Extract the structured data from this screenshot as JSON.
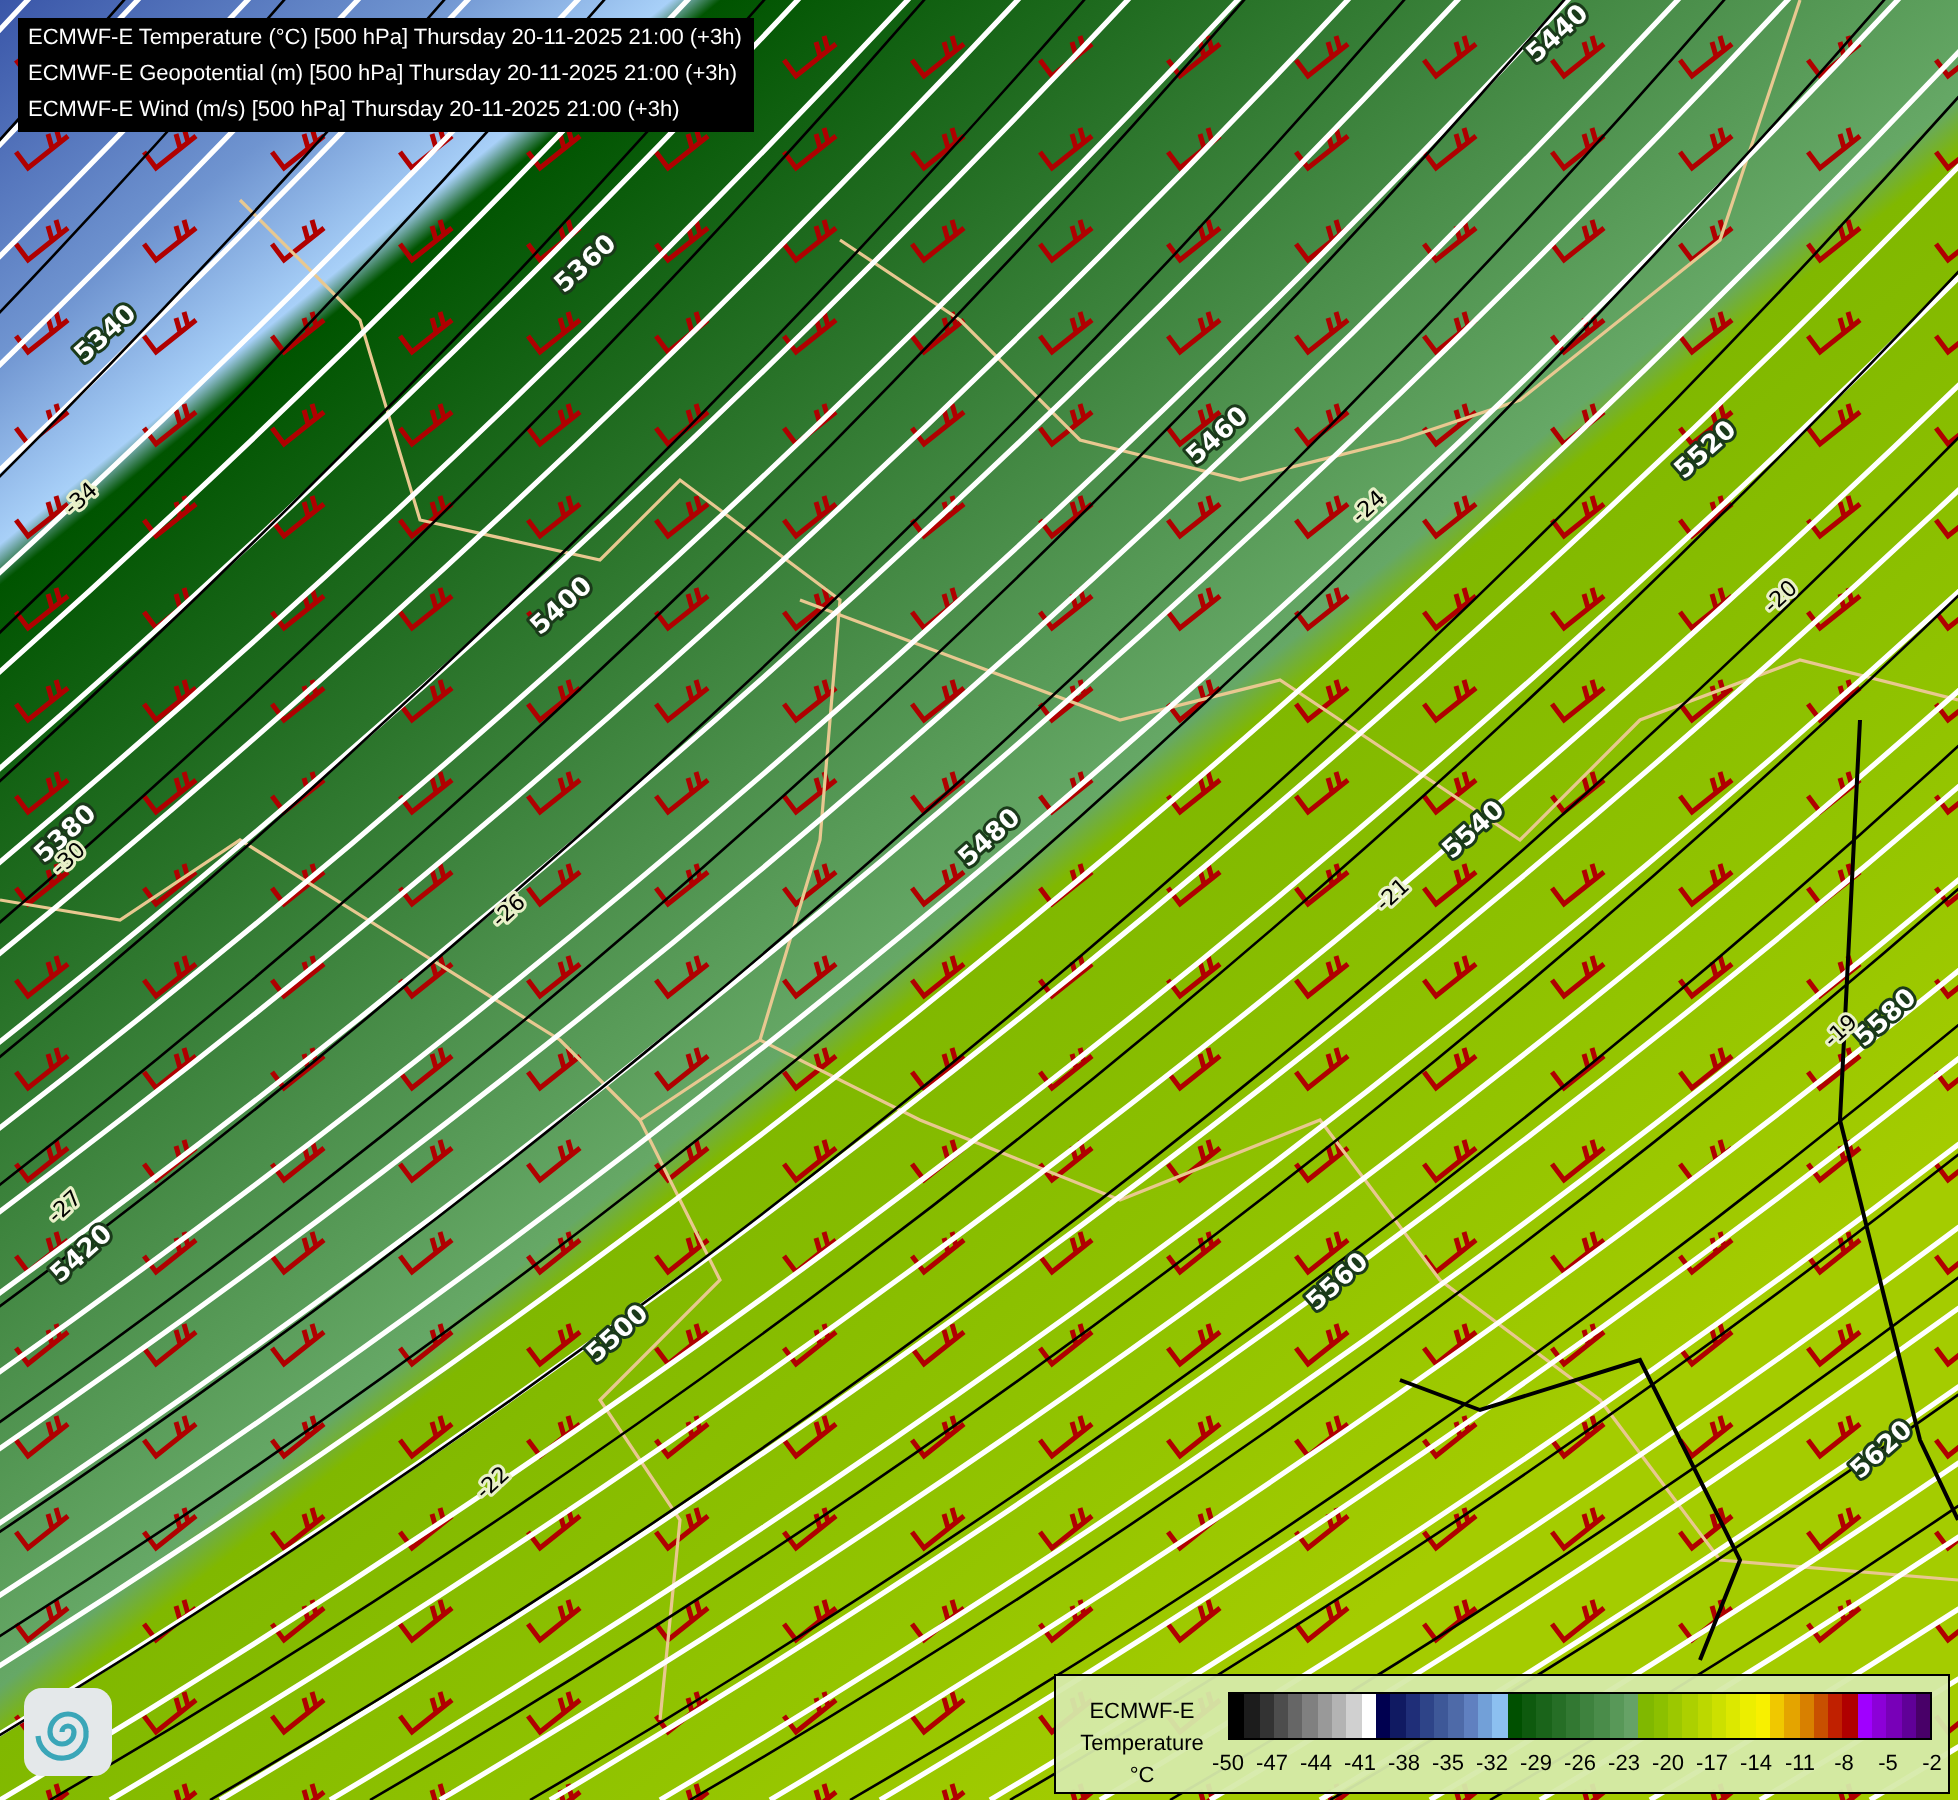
{
  "map": {
    "header_lines": [
      "ECMWF-E Temperature (°C) [500 hPa] Thursday 20-11-2025 21:00 (+3h)",
      "ECMWF-E Geopotential (m) [500 hPa] Thursday 20-11-2025 21:00 (+3h)",
      "ECMWF-E Wind (m/s) [500 hPa] Thursday 20-11-2025 21:00 (+3h)"
    ],
    "geopotential_labels": [
      "5340",
      "5360",
      "5380",
      "5400",
      "5420",
      "5440",
      "5460",
      "5480",
      "5500",
      "5520",
      "5540",
      "5560",
      "5580",
      "5620"
    ],
    "temperature_labels": [
      "-34",
      "-30",
      "-26",
      "-27",
      "-24",
      "-22",
      "-21",
      "-20",
      "-19"
    ]
  },
  "legend": {
    "model": "ECMWF-E",
    "quantity": "Temperature",
    "unit": "°C",
    "swatches": [
      {
        "color": "#000000"
      },
      {
        "color": "#1c1c1c"
      },
      {
        "color": "#333333"
      },
      {
        "color": "#4d4d4d"
      },
      {
        "color": "#666666"
      },
      {
        "color": "#808080"
      },
      {
        "color": "#999999"
      },
      {
        "color": "#b3b3b3"
      },
      {
        "color": "#d0d0d0"
      },
      {
        "color": "#ffffff"
      },
      {
        "color": "#000050"
      },
      {
        "color": "#101a62"
      },
      {
        "color": "#1f2e78"
      },
      {
        "color": "#2e4488"
      },
      {
        "color": "#3e5898"
      },
      {
        "color": "#4e6aa8"
      },
      {
        "color": "#6080c0"
      },
      {
        "color": "#72a0d8"
      },
      {
        "color": "#8cc0f0"
      },
      {
        "color": "#005000"
      },
      {
        "color": "#0e5a0e"
      },
      {
        "color": "#1a641a"
      },
      {
        "color": "#266e26"
      },
      {
        "color": "#327832"
      },
      {
        "color": "#3e823e"
      },
      {
        "color": "#4a8c4a"
      },
      {
        "color": "#589858"
      },
      {
        "color": "#66a266"
      },
      {
        "color": "#80b800"
      },
      {
        "color": "#8cc000"
      },
      {
        "color": "#9cc800"
      },
      {
        "color": "#acd000"
      },
      {
        "color": "#bcd800"
      },
      {
        "color": "#cce000"
      },
      {
        "color": "#dce800"
      },
      {
        "color": "#ecee00"
      },
      {
        "color": "#f8f000"
      },
      {
        "color": "#f0c800"
      },
      {
        "color": "#e4a400"
      },
      {
        "color": "#d88000"
      },
      {
        "color": "#c85000"
      },
      {
        "color": "#c02000"
      },
      {
        "color": "#b00000"
      },
      {
        "color": "#a000ff"
      },
      {
        "color": "#8c00d8"
      },
      {
        "color": "#7800b8"
      },
      {
        "color": "#600098"
      },
      {
        "color": "#480068"
      }
    ],
    "tick_labels": [
      "-50",
      "-47",
      "-44",
      "-41",
      "-38",
      "-35",
      "-32",
      "-29",
      "-26",
      "-23",
      "-20",
      "-17",
      "-14",
      "-11",
      "-8",
      "-5",
      "-2"
    ]
  }
}
